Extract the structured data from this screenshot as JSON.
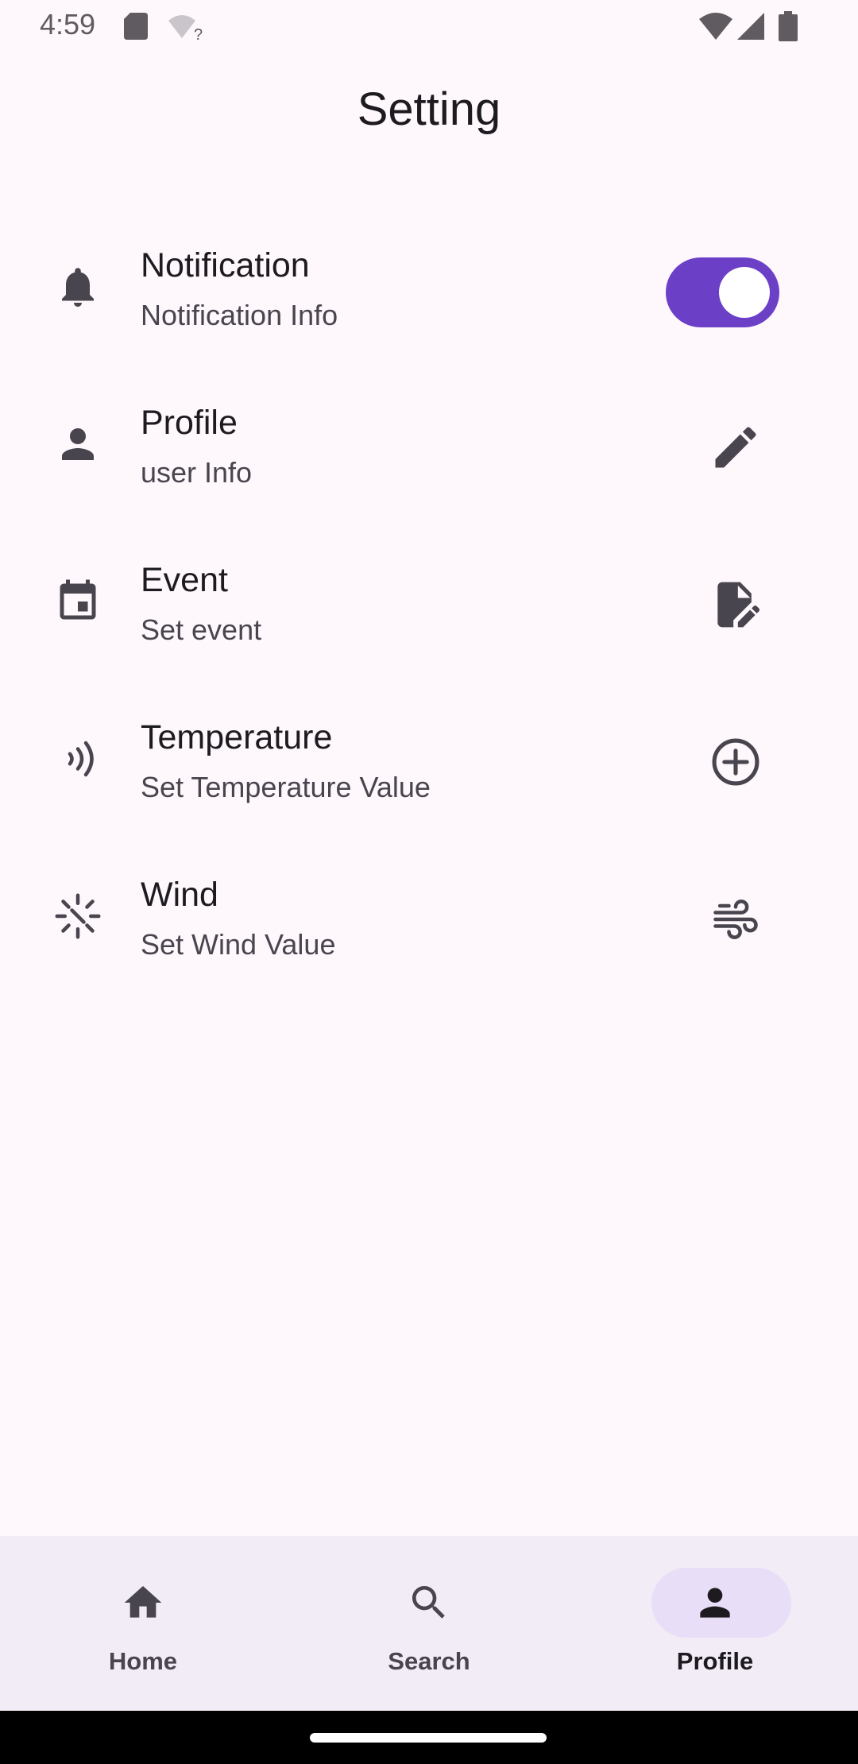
{
  "status_bar": {
    "time": "4:59",
    "icons": [
      "sd-card-icon",
      "wifi-unknown-icon",
      "wifi-icon",
      "cellular-icon",
      "battery-icon"
    ]
  },
  "app_bar": {
    "title": "Setting"
  },
  "settings": {
    "items": [
      {
        "title": "Notification",
        "subtitle": "Notification Info",
        "leading_icon": "bell-icon",
        "trailing": "switch",
        "switch_on": true
      },
      {
        "title": "Profile",
        "subtitle": "user Info",
        "leading_icon": "person-icon",
        "trailing_icon": "pencil-icon"
      },
      {
        "title": "Event",
        "subtitle": "Set event",
        "leading_icon": "calendar-icon",
        "trailing_icon": "edit-document-icon"
      },
      {
        "title": "Temperature",
        "subtitle": "Set Temperature Value",
        "leading_icon": "signal-waves-icon",
        "trailing_icon": "add-circle-icon"
      },
      {
        "title": "Wind",
        "subtitle": "Set Wind Value",
        "leading_icon": "flare-icon",
        "trailing_icon": "air-icon"
      }
    ]
  },
  "bottom_nav": {
    "items": [
      {
        "label": "Home",
        "icon": "home-icon",
        "active": false
      },
      {
        "label": "Search",
        "icon": "search-icon",
        "active": false
      },
      {
        "label": "Profile",
        "icon": "person-icon",
        "active": true
      }
    ]
  },
  "colors": {
    "background": "#FEF7FC",
    "accent": "#6C3FC7",
    "nav_background": "#F2ECF6",
    "nav_indicator": "#E8DEF8",
    "icon": "#49454F"
  }
}
